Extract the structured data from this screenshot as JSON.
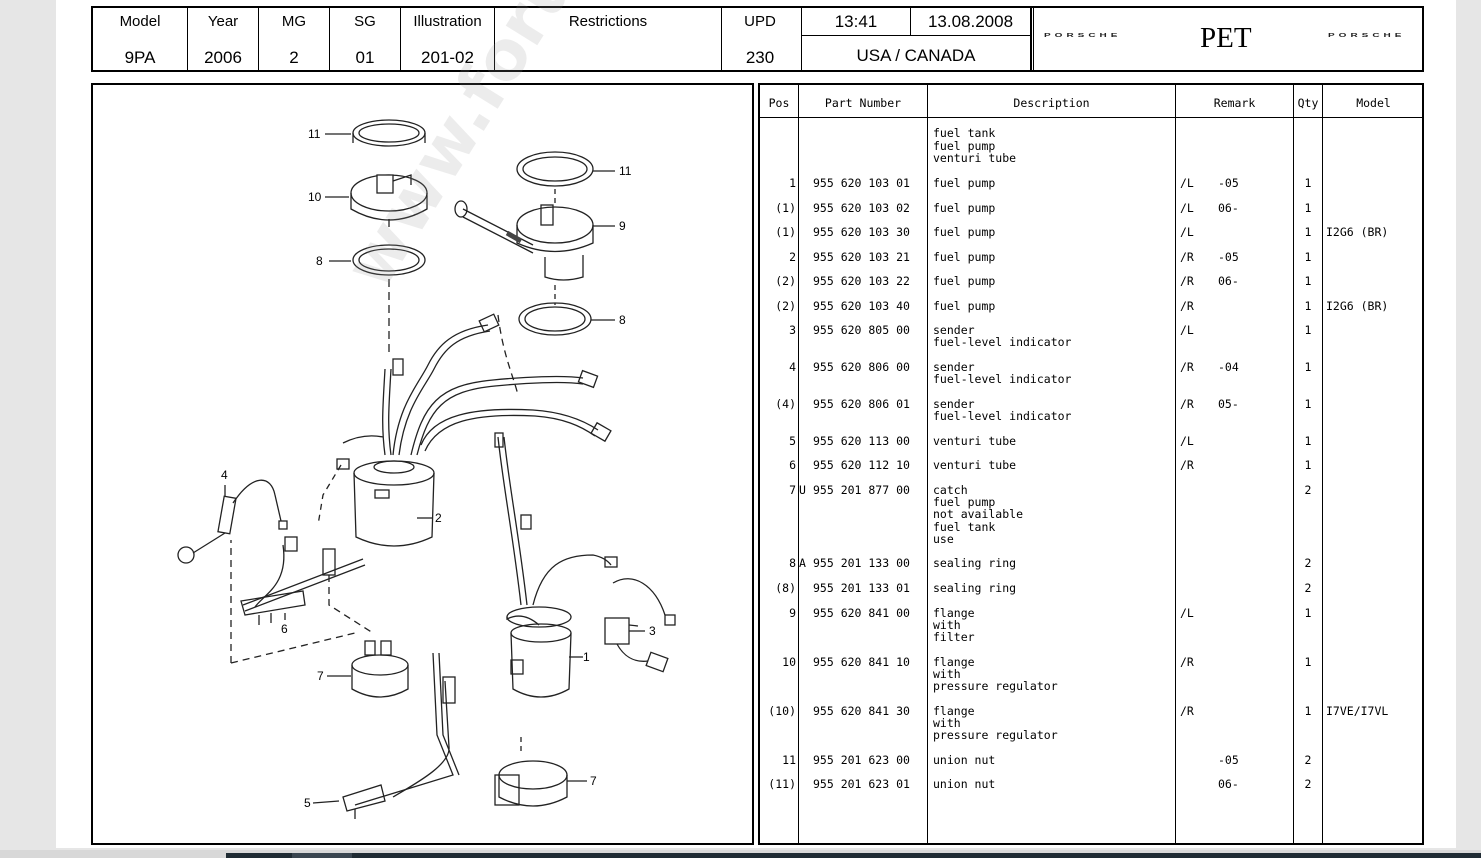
{
  "header": {
    "model": {
      "label": "Model",
      "value": "9PA"
    },
    "year": {
      "label": "Year",
      "value": "2006"
    },
    "mg": {
      "label": "MG",
      "value": "2"
    },
    "sg": {
      "label": "SG",
      "value": "01"
    },
    "illustration": {
      "label": "Illustration",
      "value": "201-02"
    },
    "restrictions": {
      "label": "Restrictions",
      "value": ""
    },
    "upd": {
      "label": "UPD",
      "value": "230"
    },
    "time": "13:41",
    "date": "13.08.2008",
    "region": "USA / CANADA",
    "brand_left": "PORSCHE",
    "app": "PET",
    "brand_right": "PORSCHE"
  },
  "watermark": "www.forum-cayenne.com",
  "diagram": {
    "callouts": [
      "11",
      "10",
      "8",
      "11",
      "9",
      "8",
      "4",
      "2",
      "6",
      "3",
      "1",
      "7",
      "5",
      "7"
    ]
  },
  "table": {
    "headers": {
      "pos": "Pos",
      "part": "Part Number",
      "desc": "Description",
      "remark": "Remark",
      "qty": "Qty",
      "model": "Model"
    },
    "intro": [
      "fuel tank",
      "fuel pump",
      "venturi tube"
    ],
    "rows": [
      {
        "pos": "1",
        "flag": "",
        "part": "955 620 103 01",
        "desc": [
          "fuel pump"
        ],
        "side": "/L",
        "rem": "-05",
        "qty": "1",
        "model": ""
      },
      {
        "pos": "(1)",
        "flag": "",
        "part": "955 620 103 02",
        "desc": [
          "fuel pump"
        ],
        "side": "/L",
        "rem": "06-",
        "qty": "1",
        "model": ""
      },
      {
        "pos": "(1)",
        "flag": "",
        "part": "955 620 103 30",
        "desc": [
          "fuel pump"
        ],
        "side": "/L",
        "rem": "",
        "qty": "1",
        "model": "I2G6 (BR)"
      },
      {
        "pos": "2",
        "flag": "",
        "part": "955 620 103 21",
        "desc": [
          "fuel pump"
        ],
        "side": "/R",
        "rem": "-05",
        "qty": "1",
        "model": ""
      },
      {
        "pos": "(2)",
        "flag": "",
        "part": "955 620 103 22",
        "desc": [
          "fuel pump"
        ],
        "side": "/R",
        "rem": "06-",
        "qty": "1",
        "model": ""
      },
      {
        "pos": "(2)",
        "flag": "",
        "part": "955 620 103 40",
        "desc": [
          "fuel pump"
        ],
        "side": "/R",
        "rem": "",
        "qty": "1",
        "model": "I2G6 (BR)"
      },
      {
        "pos": "3",
        "flag": "",
        "part": "955 620 805 00",
        "desc": [
          "sender",
          "fuel-level indicator"
        ],
        "side": "/L",
        "rem": "",
        "qty": "1",
        "model": ""
      },
      {
        "pos": "4",
        "flag": "",
        "part": "955 620 806 00",
        "desc": [
          "sender",
          "fuel-level indicator"
        ],
        "side": "/R",
        "rem": "-04",
        "qty": "1",
        "model": ""
      },
      {
        "pos": "(4)",
        "flag": "",
        "part": "955 620 806 01",
        "desc": [
          "sender",
          "fuel-level indicator"
        ],
        "side": "/R",
        "rem": "05-",
        "qty": "1",
        "model": ""
      },
      {
        "pos": "5",
        "flag": "",
        "part": "955 620 113 00",
        "desc": [
          "venturi tube"
        ],
        "side": "/L",
        "rem": "",
        "qty": "1",
        "model": ""
      },
      {
        "pos": "6",
        "flag": "",
        "part": "955 620 112 10",
        "desc": [
          "venturi tube"
        ],
        "side": "/R",
        "rem": "",
        "qty": "1",
        "model": ""
      },
      {
        "pos": "7",
        "flag": "U",
        "part": "955 201 877 00",
        "desc": [
          "catch",
          "fuel pump",
          "not available",
          "fuel tank",
          "use"
        ],
        "side": "",
        "rem": "",
        "qty": "2",
        "model": ""
      },
      {
        "pos": "8",
        "flag": "A",
        "part": "955 201 133 00",
        "desc": [
          "sealing ring"
        ],
        "side": "",
        "rem": "",
        "qty": "2",
        "model": ""
      },
      {
        "pos": "(8)",
        "flag": "",
        "part": "955 201 133 01",
        "desc": [
          "sealing ring"
        ],
        "side": "",
        "rem": "",
        "qty": "2",
        "model": ""
      },
      {
        "pos": "9",
        "flag": "",
        "part": "955 620 841 00",
        "desc": [
          "flange",
          "with",
          "filter"
        ],
        "side": "/L",
        "rem": "",
        "qty": "1",
        "model": ""
      },
      {
        "pos": "10",
        "flag": "",
        "part": "955 620 841 10",
        "desc": [
          "flange",
          "with",
          "pressure regulator"
        ],
        "side": "/R",
        "rem": "",
        "qty": "1",
        "model": ""
      },
      {
        "pos": "(10)",
        "flag": "",
        "part": "955 620 841 30",
        "desc": [
          "flange",
          "with",
          "pressure regulator"
        ],
        "side": "/R",
        "rem": "",
        "qty": "1",
        "model": "I7VE/I7VL"
      },
      {
        "pos": "11",
        "flag": "",
        "part": "955 201 623 00",
        "desc": [
          "union nut"
        ],
        "side": "",
        "rem": "-05",
        "qty": "2",
        "model": ""
      },
      {
        "pos": "(11)",
        "flag": "",
        "part": "955 201 623 01",
        "desc": [
          "union nut"
        ],
        "side": "",
        "rem": "06-",
        "qty": "2",
        "model": ""
      }
    ]
  }
}
